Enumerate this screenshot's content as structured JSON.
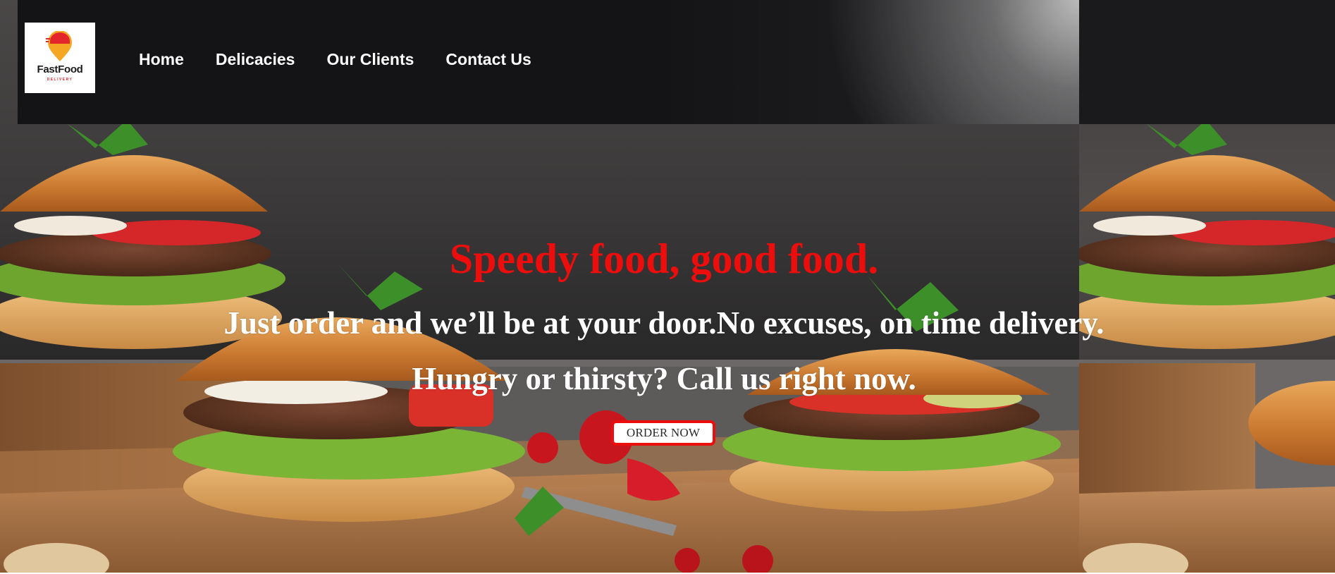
{
  "brand": {
    "name": "FastFood",
    "subtitle": "DELIVERY",
    "accent_color": "#e3262b"
  },
  "nav": {
    "items": [
      {
        "label": "Home"
      },
      {
        "label": "Delicacies"
      },
      {
        "label": "Our Clients"
      },
      {
        "label": "Contact Us"
      }
    ]
  },
  "hero": {
    "headline": "Speedy food, good food.",
    "headline_color": "#ec0d0d",
    "tagline_line1": "Just order and we’ll be at your door.No excuses, on time delivery.",
    "tagline_line2": "Hungry or thirsty? Call us right now.",
    "cta_label": "ORDER NOW",
    "background_image": "burgers-on-cutting-board"
  }
}
